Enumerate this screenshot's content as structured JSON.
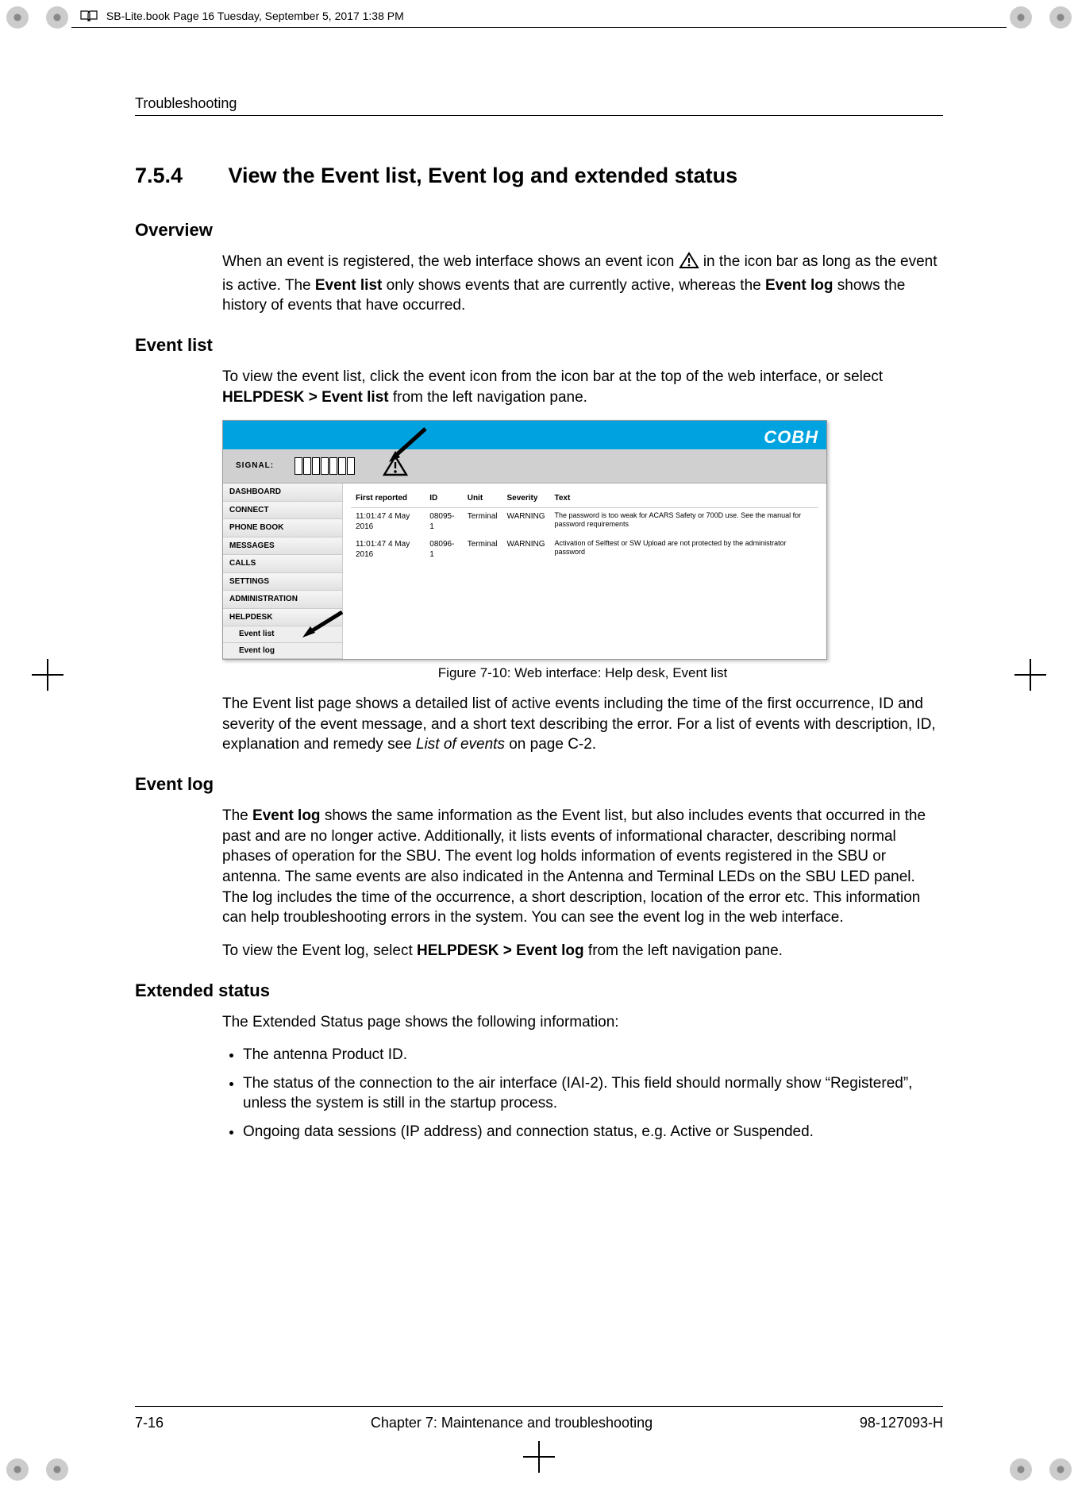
{
  "meta": {
    "tagline": "SB-Lite.book  Page 16  Tuesday, September 5, 2017  1:38 PM"
  },
  "header": {
    "running": "Troubleshooting"
  },
  "section": {
    "number": "7.5.4",
    "title": "View the Event list, Event log and extended status"
  },
  "overview": {
    "heading": "Overview",
    "p1a": "When an event is registered, the web interface shows an event icon ",
    "p1b": " in the icon bar as long as the event is active. The ",
    "bold1": "Event list",
    "p1c": " only shows events that are currently active, whereas the ",
    "bold2": "Event log",
    "p1d": " shows the history of events that have occurred."
  },
  "eventlist": {
    "heading": "Event list",
    "p1a": "To view the event list, click the event icon from the icon bar at the top of the web interface, or select ",
    "bold1": "HELPDESK > Event list",
    "p1b": " from the left navigation pane.",
    "caption": "Figure 7-10: Web interface: Help desk, Event list",
    "p2a": "The Event list page shows a detailed list of active events including the time of the first occurrence, ID and severity of the event message, and a short text describing the error. For a list of events with description, ID, explanation and remedy see ",
    "italic1": "List of events",
    "p2b": " on page C-2."
  },
  "eventlog": {
    "heading": "Event log",
    "p1a": "The ",
    "bold1": "Event log",
    "p1b": " shows the same information as the Event list, but also includes events that occurred in the past and are no longer active. Additionally, it lists events of informational character, describing normal phases of operation for the SBU. The event log holds information of events registered in the SBU or antenna. The same events are also indicated in the Antenna and Terminal LEDs on the SBU LED panel. The log includes the time of the occurrence, a short description, location of the error etc. This information can help troubleshooting errors in the system. You can see the event log in the web interface.",
    "p2a": "To view the Event log, select ",
    "bold2": "HELPDESK > Event log",
    "p2b": " from the left navigation pane."
  },
  "extended": {
    "heading": "Extended status",
    "intro": "The Extended Status page shows the following information:",
    "bullets": [
      "The antenna Product ID.",
      "The status of the connection to the air interface (IAI-2). This field should normally show “Registered”, unless the system is still in the startup process.",
      "Ongoing data sessions (IP address) and connection status, e.g. Active or Suspended."
    ]
  },
  "figure": {
    "logo": "COBH",
    "signal_label": "SIGNAL:",
    "nav": [
      "DASHBOARD",
      "CONNECT",
      "PHONE BOOK",
      "MESSAGES",
      "CALLS",
      "SETTINGS",
      "ADMINISTRATION",
      "HELPDESK"
    ],
    "nav_sub": [
      "Event list",
      "Event log"
    ],
    "columns": [
      "First reported",
      "ID",
      "Unit",
      "Severity",
      "Text"
    ],
    "rows": [
      {
        "time": "11:01:47 4 May 2016",
        "id": "08095-1",
        "unit": "Terminal",
        "sev": "WARNING",
        "text": "The password is too weak for ACARS Safety or 700D use. See the manual for password requirements"
      },
      {
        "time": "11:01:47 4 May 2016",
        "id": "08096-1",
        "unit": "Terminal",
        "sev": "WARNING",
        "text": "Activation of Selftest or SW Upload are not protected by the administrator password"
      }
    ]
  },
  "footer": {
    "left": "7-16",
    "center": "Chapter 7:  Maintenance and troubleshooting",
    "right": "98-127093-H"
  }
}
